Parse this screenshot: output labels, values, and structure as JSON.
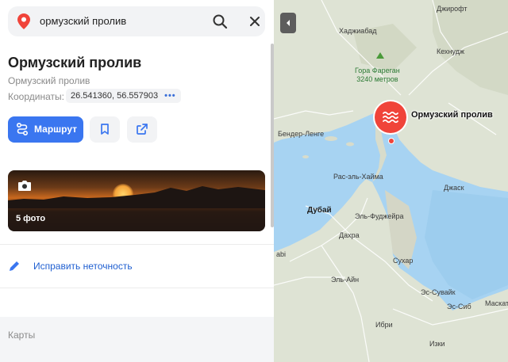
{
  "search": {
    "query": "ормузский пролив"
  },
  "place": {
    "title": "Ормузский пролив",
    "subtitle": "Ормузский пролив",
    "coords_label": "Координаты:",
    "coords_value": "26.541360, 56.557903",
    "coords_more": "•••"
  },
  "actions": {
    "route_label": "Маршрут"
  },
  "photos": {
    "count_label": "5 фото"
  },
  "fix": {
    "label": "Исправить неточность"
  },
  "footer": {
    "label": "Карты"
  },
  "map": {
    "marker_label": "Ормузский пролив",
    "peak_name": "Гора Фареган",
    "peak_height": "3240 метров",
    "labels": [
      "Джирофт",
      "Хаджиабад",
      "Кехнудж",
      "Бендер-Ленге",
      "Рас-эль-Хайма",
      "Джаск",
      "Дубай",
      "Эль-Фуджейра",
      "Дахра",
      "Сухар",
      "Эль-Айн",
      "Эс-Сувайк",
      "Эс-Сиб",
      "Маскат",
      "Ибри",
      "Изки",
      "abi"
    ],
    "colors": {
      "sea": "#a7d3f2",
      "land": "#dee3d4",
      "marker": "#f0443a"
    }
  }
}
